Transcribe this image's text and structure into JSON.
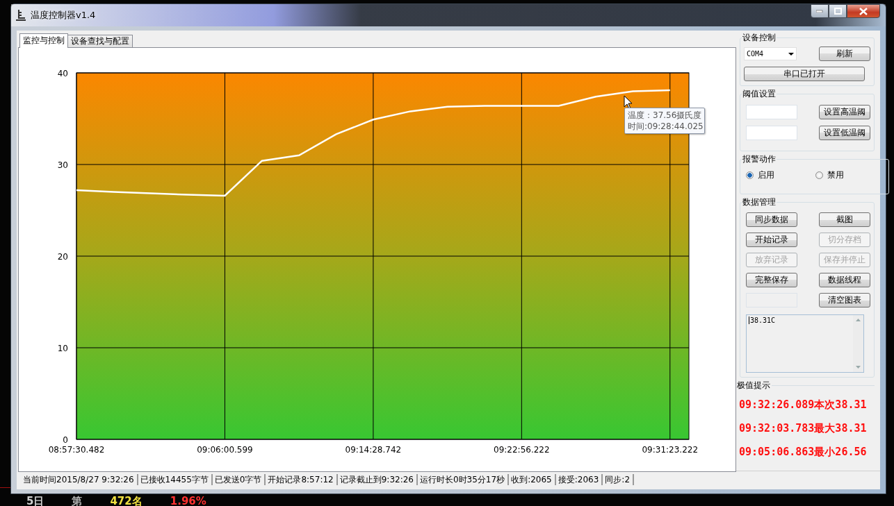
{
  "window": {
    "title": "温度控制器v1.4"
  },
  "tabs": [
    {
      "label": "监控与控制",
      "selected": true
    },
    {
      "label": "设备查找与配置",
      "selected": false
    }
  ],
  "chart": {
    "chart_data": {
      "type": "line",
      "categories": [
        "08:57:30.482",
        null,
        null,
        null,
        "09:06:00.599",
        null,
        null,
        null,
        "09:14:28.742",
        null,
        null,
        null,
        "09:22:56.222",
        null,
        null,
        null,
        "09:31:23.222"
      ],
      "series": [
        {
          "color": "#ffffff",
          "values": [
            27.2,
            27.0,
            26.85,
            26.7,
            26.6,
            30.4,
            31.0,
            33.3,
            34.9,
            35.8,
            36.3,
            36.4,
            36.4,
            36.4,
            37.4,
            38.0,
            38.1
          ]
        }
      ],
      "ylim": [
        0,
        40
      ],
      "grid": true,
      "yticks": [
        0,
        10,
        20,
        30,
        40
      ]
    },
    "tooltip": {
      "lines": [
        "温度：37.56摄氏度",
        "时间:09:28:44.025"
      ]
    }
  },
  "device_control": {
    "title": "设备控制",
    "port": "COM4",
    "refresh": "刷新",
    "open_port": "串口已打开"
  },
  "threshold": {
    "title": "阈值设置",
    "rows": [
      {
        "button": "设置高温阈"
      },
      {
        "button": "设置低温阈"
      }
    ]
  },
  "alarm": {
    "title": "报警动作",
    "options": [
      {
        "label": "启用",
        "selected": true
      },
      {
        "label": "禁用",
        "selected": false
      }
    ]
  },
  "data_management": {
    "title": "数据管理",
    "buttons": [
      {
        "label": "同步数据",
        "disabled": false
      },
      {
        "label": "截图",
        "disabled": false
      },
      {
        "label": "开始记录",
        "disabled": false
      },
      {
        "label": "切分存档",
        "disabled": true
      },
      {
        "label": "放弃记录",
        "disabled": true
      },
      {
        "label": "保存并停止",
        "disabled": true
      },
      {
        "label": "完整保存",
        "disabled": false
      },
      {
        "label": "数据线程",
        "disabled": false
      }
    ],
    "clear": "清空图表",
    "log": "38.31C"
  },
  "extremes": {
    "title": "极值提示",
    "lines": [
      "09:32:26.089本次38.31",
      "09:32:03.783最大38.31",
      "09:05:06.863最小26.56"
    ]
  },
  "status_bar": [
    "当前时间2015/8/27 9:32:26",
    "已接收14455字节",
    "已发送0字节",
    "开始记录8:57:12",
    "记录截止到9:32:26",
    "运行时长0时35分17秒",
    "收到:2065",
    "接受:2063",
    "同步:2"
  ],
  "background": {
    "texts": [
      {
        "text": "5日",
        "color": "#d0d0d0"
      },
      {
        "text": "第",
        "color": "#b0b0b0"
      },
      {
        "text": "472名",
        "color": "#f0e040"
      },
      {
        "text": "1.96%",
        "color": "#ff3030"
      }
    ]
  }
}
